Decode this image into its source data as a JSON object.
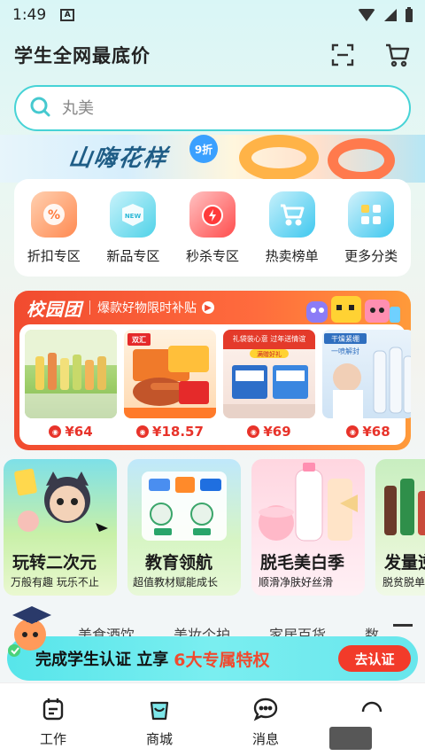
{
  "status": {
    "time": "1:49",
    "notif_icon": "A"
  },
  "header": {
    "title": "学生全网最底价",
    "icons": [
      "scan-icon",
      "cart-icon"
    ]
  },
  "search": {
    "placeholder": "丸美"
  },
  "banner": {
    "text": "山嗨花样",
    "badge": "9折"
  },
  "categories": [
    {
      "label": "折扣专区",
      "icon": "discount-icon",
      "color": "#ff8a52"
    },
    {
      "label": "新品专区",
      "icon": "new-icon",
      "color": "#4fd2e8"
    },
    {
      "label": "秒杀专区",
      "icon": "flash-sale-icon",
      "color": "#ff4d4d"
    },
    {
      "label": "热卖榜单",
      "icon": "hot-cart-icon",
      "color": "#3fc8ef"
    },
    {
      "label": "更多分类",
      "icon": "grid-icon",
      "color": "#3fc8ef"
    }
  ],
  "campus": {
    "logo": "校园团",
    "subtitle": "爆款好物限时补贴",
    "products": [
      {
        "price": "¥64"
      },
      {
        "price": "¥18.57"
      },
      {
        "price": "¥69"
      },
      {
        "price": "¥68"
      }
    ],
    "product_texts": {
      "p2_tag": "双汇",
      "p3_tag": "礼袋装心意 过年送情谊",
      "p3_sub": "满赠好礼",
      "p4_tag": "干燥紧绷",
      "p4_sub": "一喷解封"
    }
  },
  "promos": [
    {
      "title": "玩转二次元",
      "subtitle": "万般有趣 玩乐不止"
    },
    {
      "title": "教育领航",
      "subtitle": "超值教材赋能成长"
    },
    {
      "title": "脱毛美白季",
      "subtitle": "顺滑净肤好丝滑"
    },
    {
      "title": "发量逆",
      "subtitle": "脱贫脱单"
    }
  ],
  "tabs": [
    "美食酒饮",
    "美妆个护",
    "家居百货",
    "数"
  ],
  "cert": {
    "text": "完成学生认证 立享",
    "highlight": "6大专属特权",
    "button": "去认证"
  },
  "nav": [
    {
      "label": "工作",
      "icon": "work-icon"
    },
    {
      "label": "商城",
      "icon": "shop-bag-icon"
    },
    {
      "label": "消息",
      "icon": "message-icon"
    },
    {
      "label": "",
      "icon": "profile-icon"
    }
  ]
}
